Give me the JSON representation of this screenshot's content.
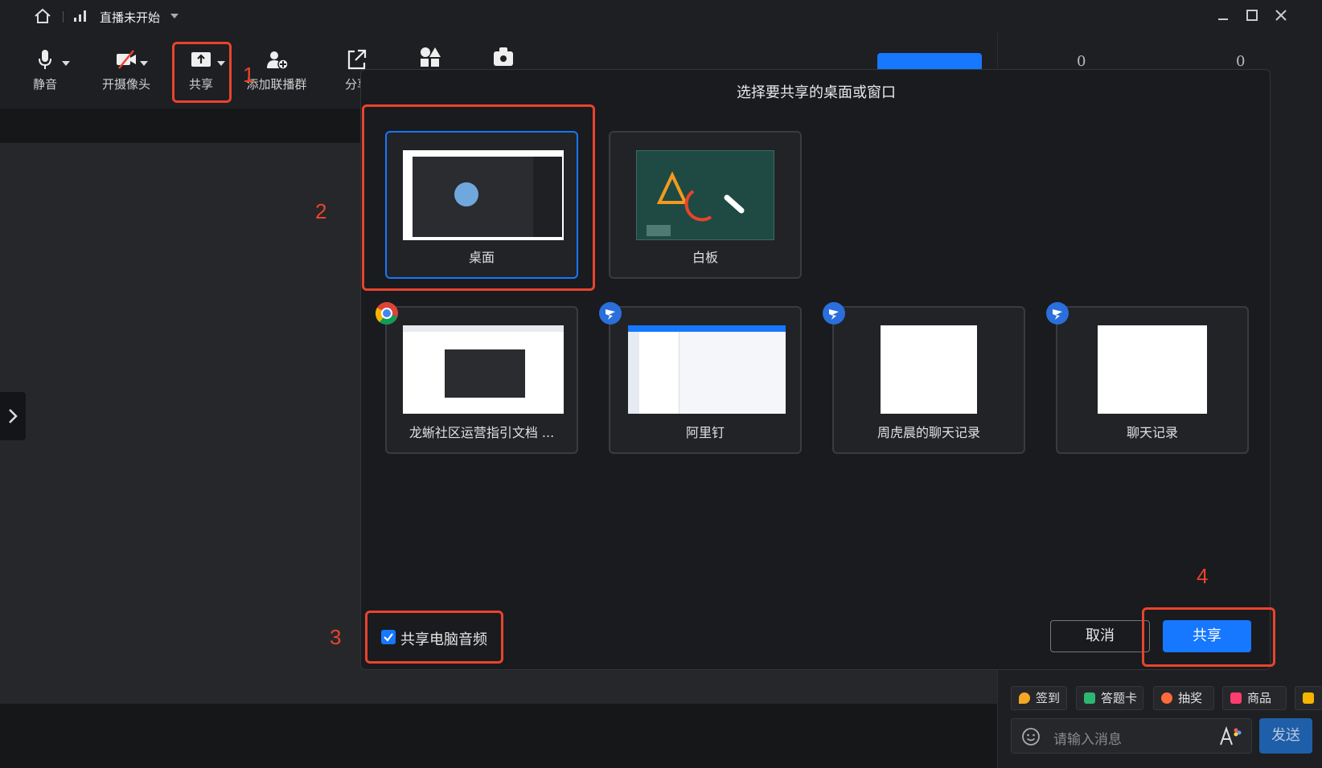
{
  "titlebar": {
    "status": "直播未开始"
  },
  "toolbar": {
    "mute_label": "静音",
    "camera_label": "开摄像头",
    "share_label": "共享",
    "add_group_label": "添加联播群",
    "share_link_label": "分享"
  },
  "right_panel": {
    "count_a": "0",
    "count_b": "0"
  },
  "modal": {
    "title": "选择要共享的桌面或窗口",
    "cards": [
      {
        "label": "桌面"
      },
      {
        "label": "白板"
      },
      {
        "label": "龙蜥社区运营指引文档 ...",
        "app_icon": "chrome-icon"
      },
      {
        "label": "阿里钉",
        "app_icon": "dingtalk-icon"
      },
      {
        "label": "周虎晨的聊天记录",
        "app_icon": "dingtalk-icon"
      },
      {
        "label": "聊天记录",
        "app_icon": "dingtalk-icon"
      }
    ],
    "share_audio_label": "共享电脑音频",
    "share_audio_checked": true,
    "cancel_label": "取消",
    "share_label": "共享"
  },
  "annotations": {
    "n1": "1",
    "n2": "2",
    "n3": "3",
    "n4": "4"
  },
  "chat": {
    "tags": [
      "签到",
      "答题卡",
      "抽奖",
      "商品"
    ],
    "input_placeholder": "请输入消息",
    "send_label": "发送"
  },
  "colors": {
    "accent": "#1677ff",
    "annotation": "#e8442d",
    "background": "#161719"
  }
}
